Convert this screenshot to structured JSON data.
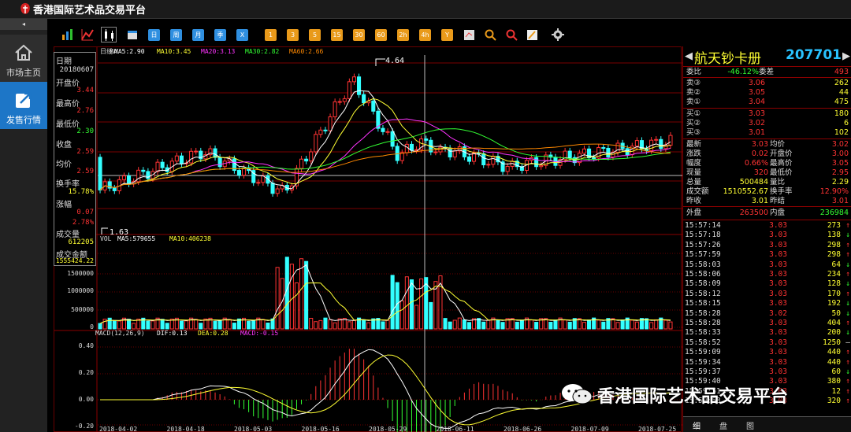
{
  "app": {
    "title": "香港国际艺术品交易平台"
  },
  "sidebar": {
    "collapse": "◂",
    "items": [
      {
        "label": "市场主页",
        "icon": "home-icon"
      },
      {
        "label": "发售行情",
        "icon": "external-link-icon"
      }
    ]
  },
  "toolbar": {
    "blue_buttons": [
      "日",
      "周",
      "月",
      "季",
      "X"
    ],
    "period_buttons": [
      "1",
      "3",
      "5",
      "15",
      "30",
      "60",
      "2h",
      "4h",
      "Y"
    ]
  },
  "chart": {
    "period_label": "日线",
    "ma_legend": {
      "ma": "MA",
      "ma5": "MA5:2.90",
      "ma10": "MA10:3.45",
      "ma20": "MA20:3.13",
      "ma30": "MA30:2.82",
      "ma60": "MA60:2.66"
    },
    "price_high_label": "4.64",
    "price_low_label": "1.63",
    "price_axis": [
      "3.44",
      "2.76",
      "2.30",
      "2.59",
      "2.59"
    ],
    "vol_legend": {
      "vol": "VOL",
      "ma5": "MA5:579655",
      "ma10": "MA10:406238"
    },
    "vol_axis": [
      "1500000",
      "1000000",
      "500000",
      "0"
    ],
    "macd_legend": {
      "macd": "MACD(12,26,9)",
      "dif": "DIF:0.13",
      "dea": "DEA:0.28",
      "val": "MACD:-0.15"
    },
    "macd_axis": [
      "0.40",
      "0.20",
      "0.00",
      "-0.20"
    ],
    "dates": [
      "2018-04-02",
      "2018-04-18",
      "2018-05-03",
      "2018-05-16",
      "2018-05-29",
      "2018-06-11",
      "2018-06-26",
      "2018-07-09",
      "2018-07-25"
    ]
  },
  "info_panel": [
    {
      "label": "日期",
      "value": "20180607",
      "color": "#dddddd"
    },
    {
      "label": "开盘价",
      "value": "3.44",
      "color": "#ff3333"
    },
    {
      "label": "最高价",
      "value": "2.76",
      "color": "#ff3333"
    },
    {
      "label": "最低价",
      "value": "2.30",
      "color": "#33ff33"
    },
    {
      "label": "收盘",
      "value": "2.59",
      "color": "#ff3333"
    },
    {
      "label": "均价",
      "value": "2.59",
      "color": "#ff3333"
    },
    {
      "label": "换手率",
      "value": "15.78%",
      "color": "#ffff33"
    },
    {
      "label": "涨幅",
      "value": "0.07",
      "color": "#ff3333"
    },
    {
      "label": "",
      "value": "2.78%",
      "color": "#ff3333"
    },
    {
      "label": "成交量",
      "value": "612205",
      "color": "#ffff33"
    },
    {
      "label": "成交金额",
      "value": "1555424.22",
      "color": "#ffff33"
    }
  ],
  "quote": {
    "name": "航天钞卡册",
    "code": "207701",
    "weibi_label": "委比",
    "weibi": "-46.12%",
    "weicha_label": "委差",
    "weicha": "493",
    "asks": [
      {
        "label": "卖③",
        "price": "3.06",
        "vol": "262"
      },
      {
        "label": "卖②",
        "price": "3.05",
        "vol": "44"
      },
      {
        "label": "卖①",
        "price": "3.04",
        "vol": "475"
      }
    ],
    "bids": [
      {
        "label": "买①",
        "price": "3.03",
        "vol": "180"
      },
      {
        "label": "买②",
        "price": "3.02",
        "vol": "6"
      },
      {
        "label": "买③",
        "price": "3.01",
        "vol": "102"
      }
    ],
    "stats": [
      {
        "l1": "最新",
        "v1": "3.03",
        "l2": "均价",
        "v2": "3.02"
      },
      {
        "l1": "涨跌",
        "v1": "0.02",
        "l2": "开盘价",
        "v2": "3.00"
      },
      {
        "l1": "幅度",
        "v1": "0.66%",
        "l2": "最高价",
        "v2": "3.05"
      },
      {
        "l1": "现量",
        "v1": "320",
        "l2": "最低价",
        "v2": "2.95"
      },
      {
        "l1": "总量",
        "v1": "500484",
        "l2": "量比",
        "v2": "2.29"
      },
      {
        "l1": "成交额",
        "v1": "1510552.67",
        "l2": "换手率",
        "v2": "12.90%"
      },
      {
        "l1": "昨收",
        "v1": "3.01",
        "l2": "昨结",
        "v2": "3.01"
      }
    ],
    "outer_label": "外盘",
    "outer": "263500",
    "inner_label": "内盘",
    "inner": "236984"
  },
  "trades": [
    {
      "time": "15:57:14",
      "price": "3.03",
      "vol": "273",
      "dir": "↑"
    },
    {
      "time": "15:57:18",
      "price": "3.03",
      "vol": "138",
      "dir": "↓"
    },
    {
      "time": "15:57:26",
      "price": "3.03",
      "vol": "298",
      "dir": "↑"
    },
    {
      "time": "15:57:59",
      "price": "3.03",
      "vol": "298",
      "dir": "↑"
    },
    {
      "time": "15:58:03",
      "price": "3.03",
      "vol": "64",
      "dir": "↓"
    },
    {
      "time": "15:58:06",
      "price": "3.03",
      "vol": "234",
      "dir": "↑"
    },
    {
      "time": "15:58:09",
      "price": "3.03",
      "vol": "128",
      "dir": "↓"
    },
    {
      "time": "15:58:12",
      "price": "3.03",
      "vol": "170",
      "dir": "↑"
    },
    {
      "time": "15:58:15",
      "price": "3.03",
      "vol": "192",
      "dir": "↓"
    },
    {
      "time": "15:58:28",
      "price": "3.02",
      "vol": "50",
      "dir": "↓"
    },
    {
      "time": "15:58:28",
      "price": "3.03",
      "vol": "404",
      "dir": "↑"
    },
    {
      "time": "15:58:33",
      "price": "3.03",
      "vol": "200",
      "dir": "↓"
    },
    {
      "time": "15:58:52",
      "price": "3.03",
      "vol": "1250",
      "dir": "—"
    },
    {
      "time": "15:59:09",
      "price": "3.03",
      "vol": "440",
      "dir": "↑"
    },
    {
      "time": "15:59:34",
      "price": "3.03",
      "vol": "440",
      "dir": "↑"
    },
    {
      "time": "15:59:37",
      "price": "3.03",
      "vol": "60",
      "dir": "↓"
    },
    {
      "time": "15:59:40",
      "price": "3.03",
      "vol": "380",
      "dir": "↑"
    },
    {
      "time": "15:59:51",
      "price": "3.03",
      "vol": "12",
      "dir": "↑"
    },
    {
      "time": "15:59:53",
      "price": "3.03",
      "vol": "320",
      "dir": "↑"
    }
  ],
  "right_tabs": [
    "细",
    "盘",
    "图"
  ],
  "watermark": "香港国际艺术品交易平台",
  "colors": {
    "up": "#ff3333",
    "down": "#33ffff",
    "accent": "#1d76c7"
  }
}
